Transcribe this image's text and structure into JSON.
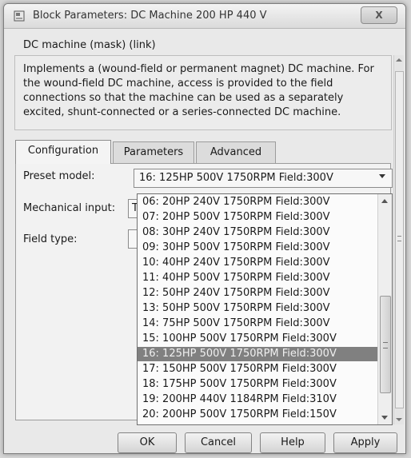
{
  "window": {
    "title": "Block Parameters: DC Machine 200 HP 440 V",
    "close_glyph": "X"
  },
  "mask": {
    "header": "DC machine (mask) (link)",
    "description": "Implements a (wound-field or permanent magnet) DC machine. For the wound-field DC machine, access is provided to the field connections so that the machine can be used as a separately excited, shunt-connected or a series-connected  DC machine."
  },
  "tabs": [
    {
      "label": "Configuration",
      "active": true
    },
    {
      "label": "Parameters",
      "active": false
    },
    {
      "label": "Advanced",
      "active": false
    }
  ],
  "params": {
    "preset_model_label": "Preset  model:",
    "preset_model_value": "16: 125HP 500V 1750RPM Field:300V",
    "mechanical_input_label": "Mechanical input:",
    "mechanical_input_value": "T",
    "field_type_label": "Field type:"
  },
  "dropdown": {
    "selected_index": 10,
    "options": [
      "06: 20HP 240V 1750RPM Field:300V",
      "07: 20HP 500V 1750RPM Field:300V",
      "08: 30HP 240V 1750RPM Field:300V",
      "09: 30HP 500V 1750RPM Field:300V",
      "10: 40HP 240V 1750RPM Field:300V",
      "11: 40HP 500V 1750RPM Field:300V",
      "12: 50HP 240V 1750RPM Field:300V",
      "13: 50HP 500V 1750RPM Field:300V",
      "14: 75HP 500V 1750RPM Field:300V",
      "15: 100HP 500V 1750RPM Field:300V",
      "16: 125HP 500V 1750RPM Field:300V",
      "17: 150HP 500V 1750RPM Field:300V",
      "18: 175HP 500V 1750RPM Field:300V",
      "19: 200HP 440V 1184RPM Field:310V",
      "20: 200HP 500V 1750RPM Field:150V"
    ]
  },
  "buttons": {
    "ok": "OK",
    "cancel": "Cancel",
    "help": "Help",
    "apply": "Apply"
  }
}
